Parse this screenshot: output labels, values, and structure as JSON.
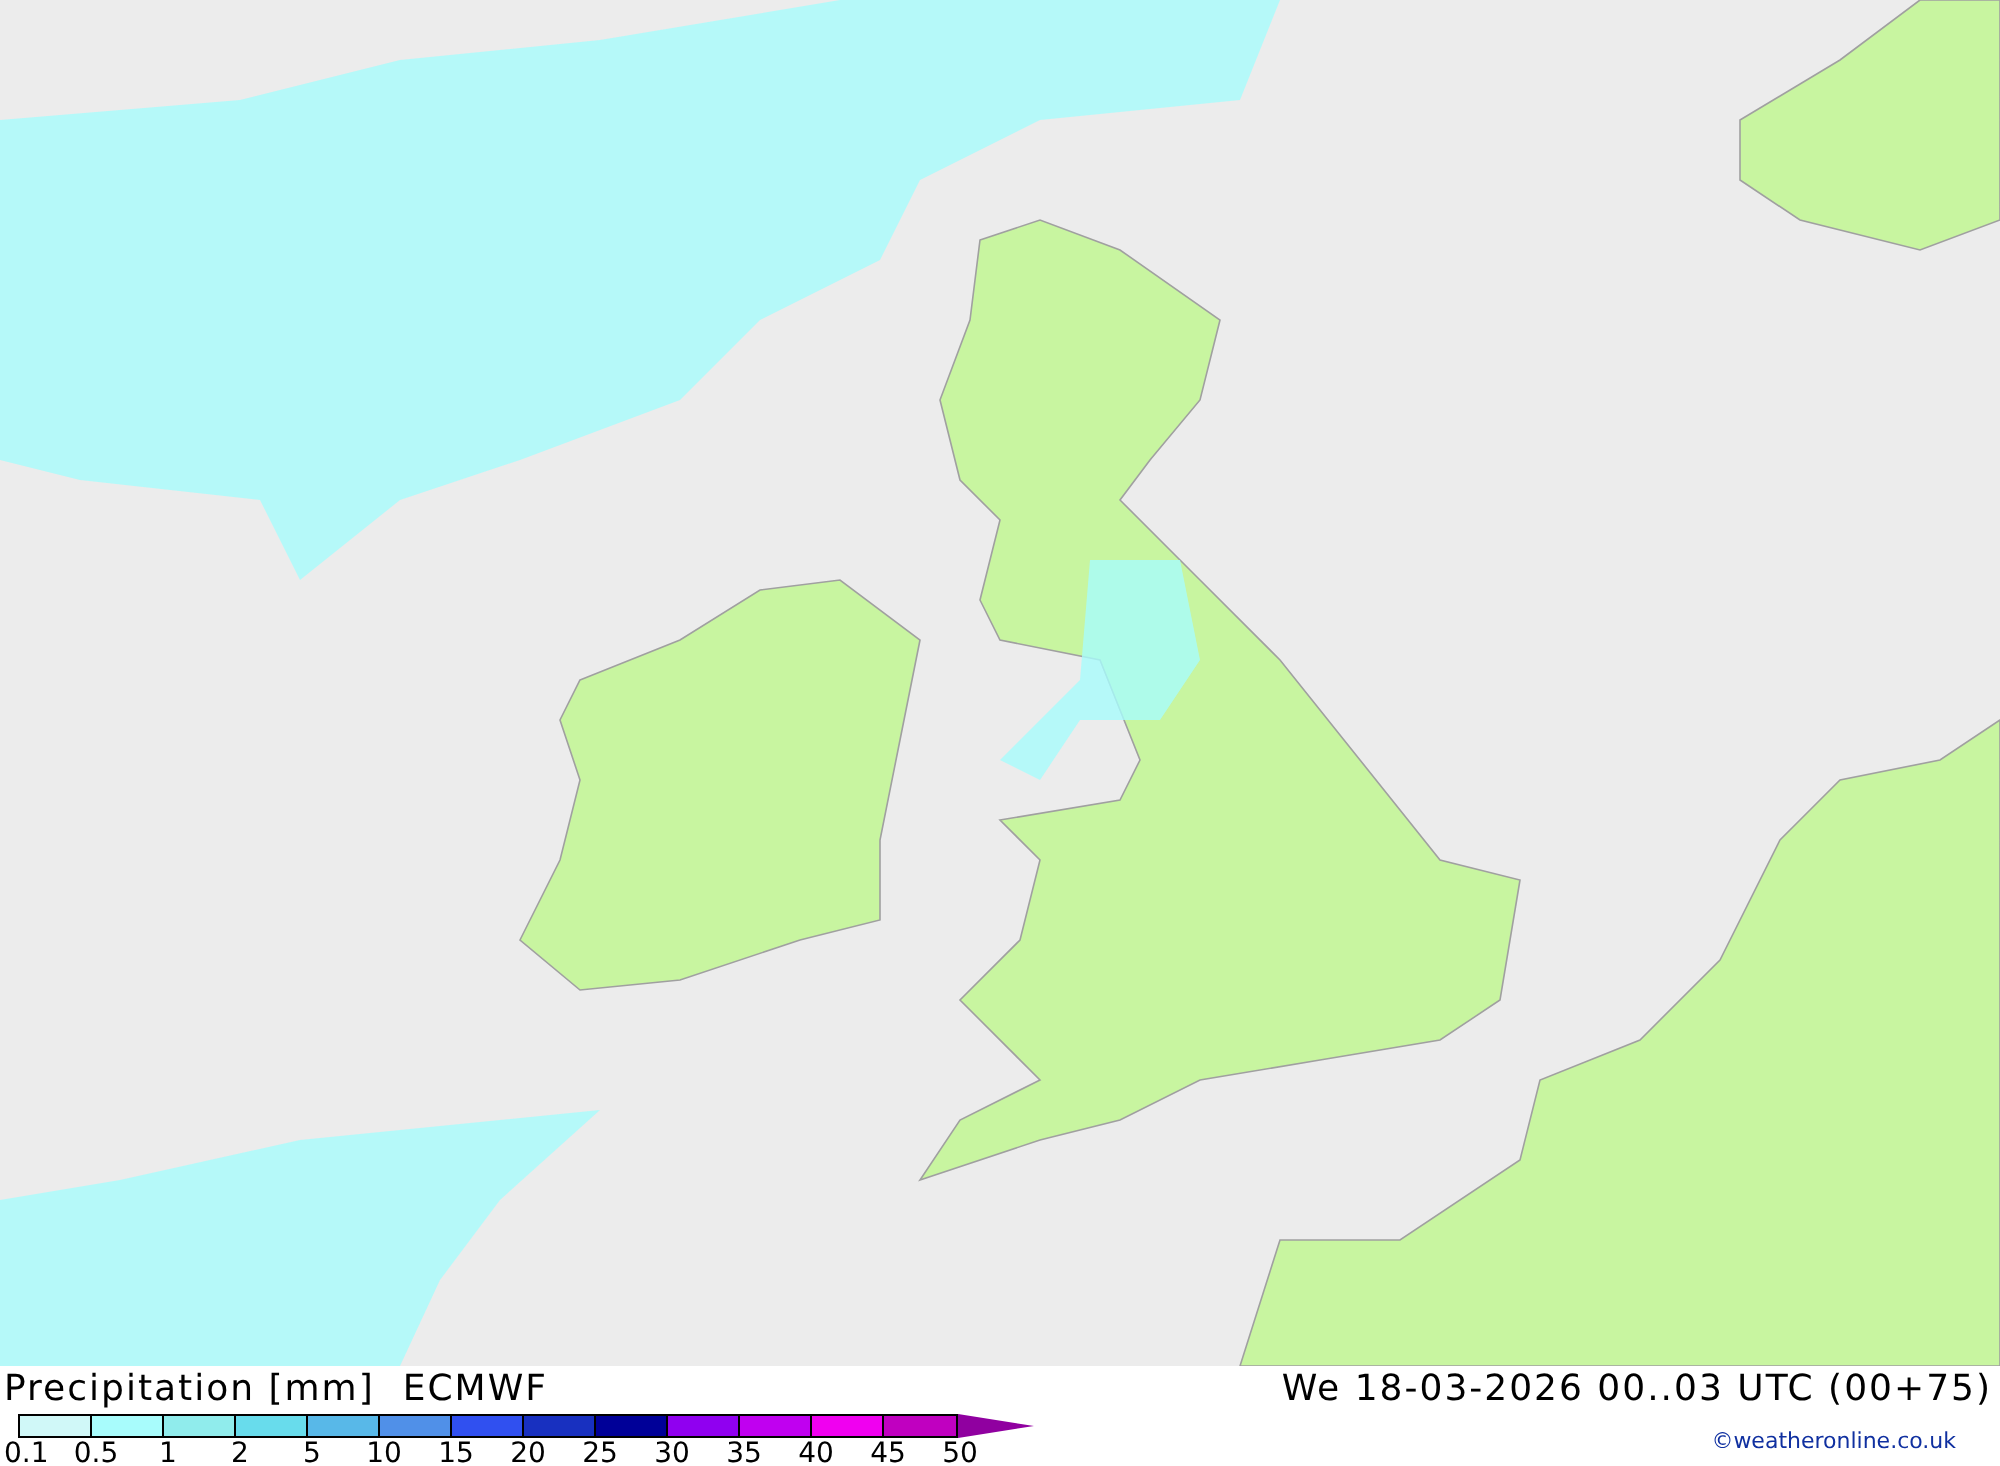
{
  "title": "Precipitation [mm]",
  "model": "ECMWF",
  "valid_time": "We 18-03-2026 00..03 UTC (00+75)",
  "legend": {
    "segments": [
      {
        "color": "#d0f8f8"
      },
      {
        "color": "#a8fcfc"
      },
      {
        "color": "#90ecec"
      },
      {
        "color": "#68dcec"
      },
      {
        "color": "#58b8e8"
      },
      {
        "color": "#5090e8"
      },
      {
        "color": "#3050f0"
      },
      {
        "color": "#1830c0"
      },
      {
        "color": "#000098"
      },
      {
        "color": "#9000f0"
      },
      {
        "color": "#c000f0"
      },
      {
        "color": "#f000f0"
      },
      {
        "color": "#c000c0"
      }
    ],
    "labels": [
      "0.1",
      "0.5",
      "1",
      "2",
      "5",
      "10",
      "15",
      "20",
      "25",
      "30",
      "35",
      "40",
      "45",
      "50"
    ]
  },
  "credit": "©weatheronline.co.uk"
}
